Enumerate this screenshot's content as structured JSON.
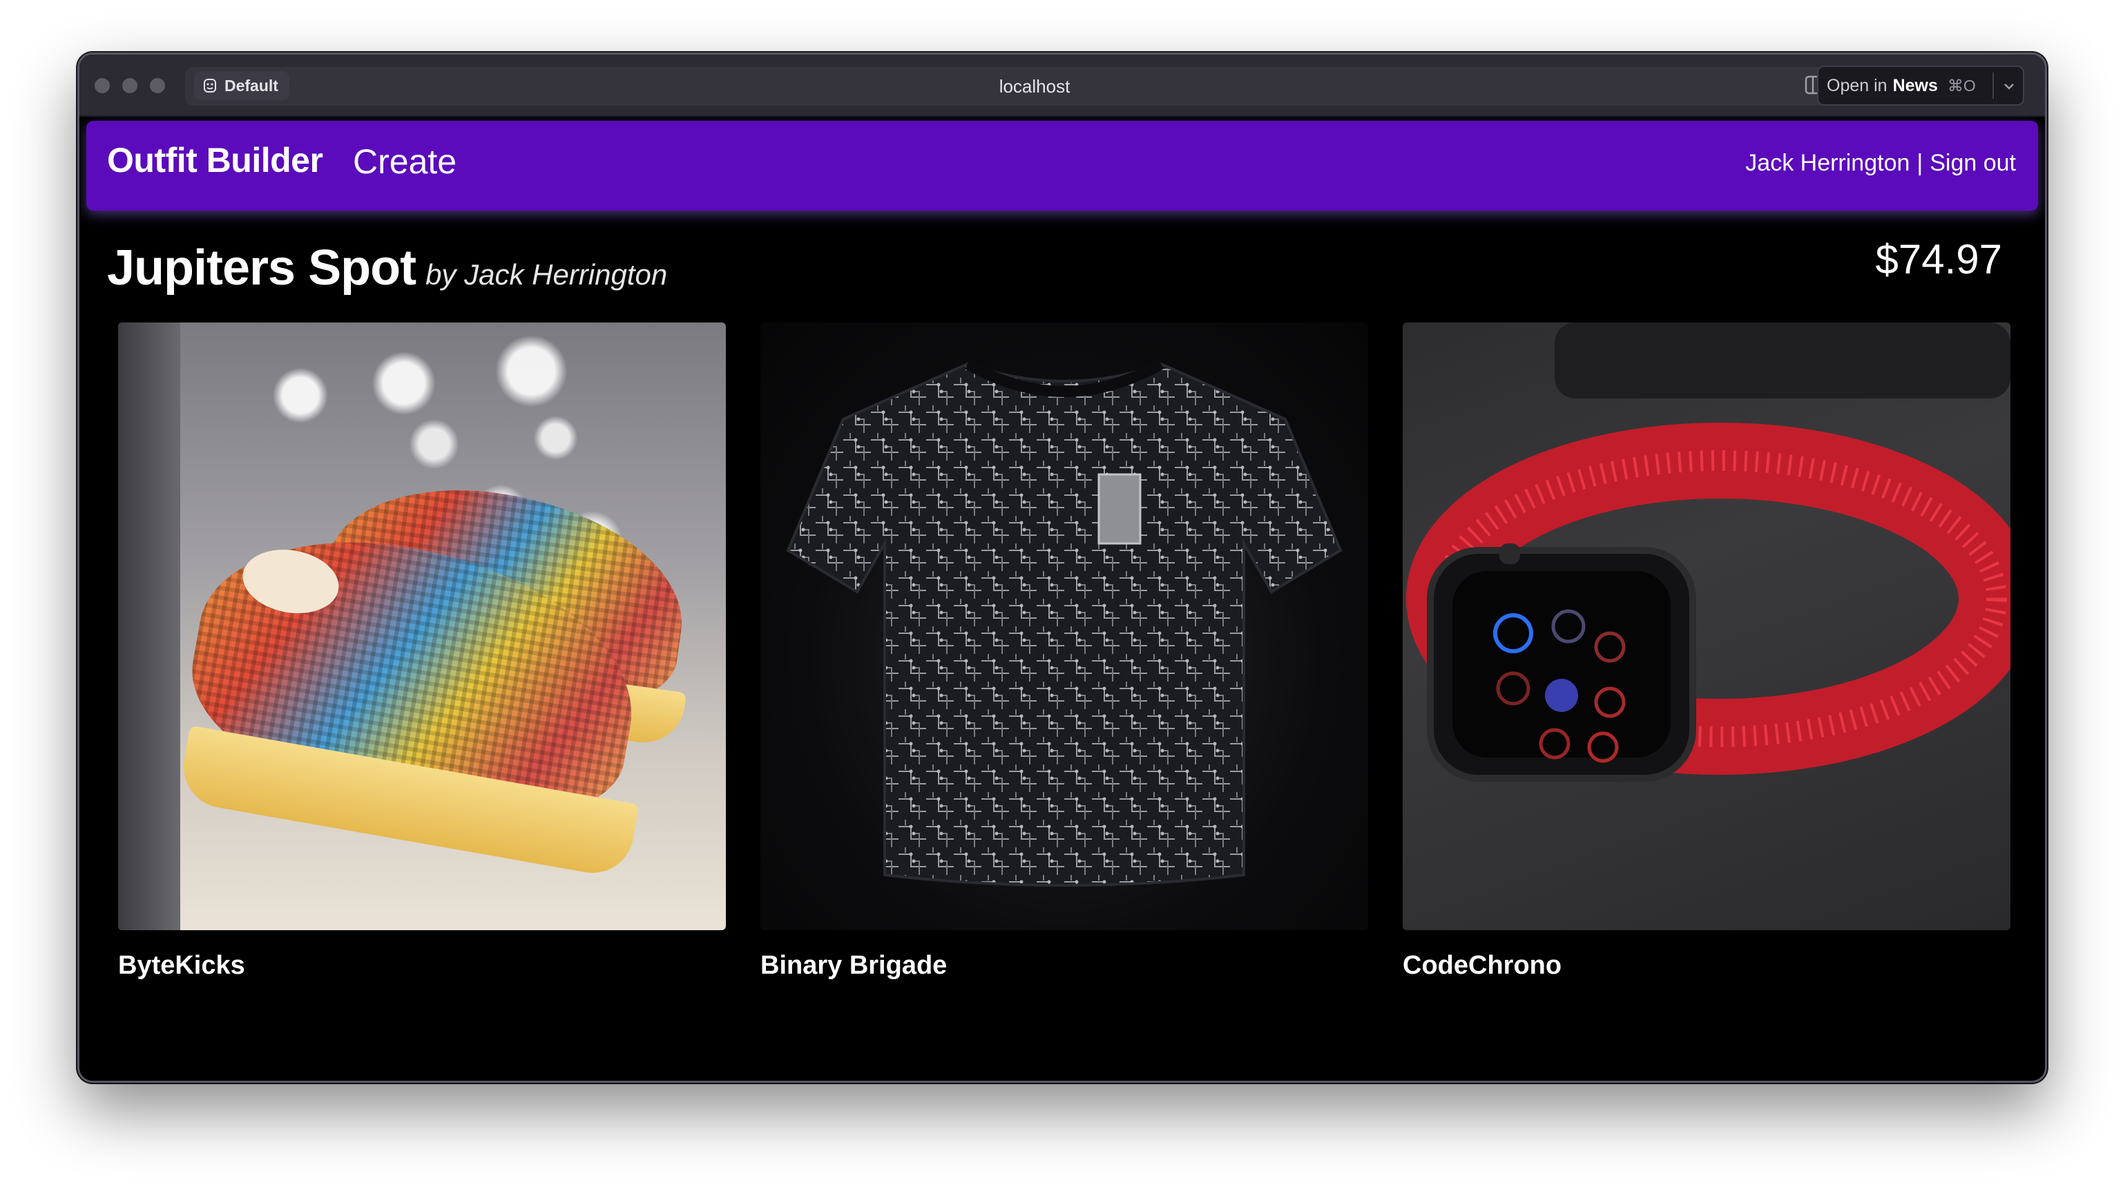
{
  "browser": {
    "profile_label": "Default",
    "address": "localhost",
    "open_in_prefix": "Open in",
    "open_in_app": "News",
    "open_in_shortcut": "⌘O"
  },
  "nav": {
    "brand": "Outfit Builder",
    "create": "Create",
    "user": "Jack Herrington",
    "separator": "|",
    "sign_out": "Sign out",
    "color": "#5b0bbb"
  },
  "outfit": {
    "name": "Jupiters Spot",
    "author": "by Jack Herrington",
    "price": "$74.97"
  },
  "products": [
    {
      "name": "ByteKicks",
      "image": "shoes-image"
    },
    {
      "name": "Binary Brigade",
      "image": "shirt-image"
    },
    {
      "name": "CodeChrono",
      "image": "watch-image"
    }
  ]
}
